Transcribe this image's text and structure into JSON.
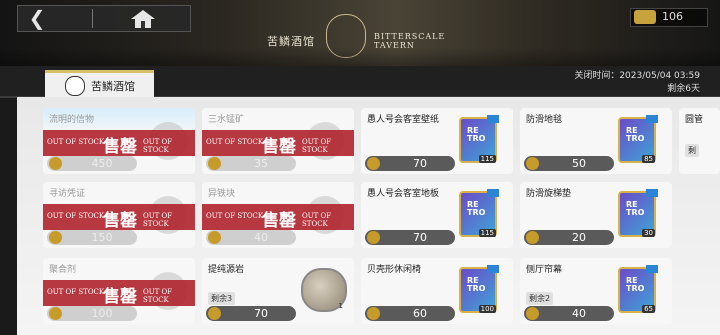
{
  "header": {
    "logo_cn": "苦鳞酒馆",
    "logo_en_line1": "BITTERSCALE",
    "logo_en_line2": "TAVERN",
    "currency_value": "106"
  },
  "tab": {
    "label": "苦鳞酒馆"
  },
  "close_info": {
    "label": "关闭时间：",
    "date": "2023/05/04 03:59",
    "remaining": "剩余6天"
  },
  "soldout": {
    "en": "OUT OF STOCK",
    "cn": "售罄"
  },
  "items": [
    {
      "name": "流明的信物",
      "price": "450",
      "sold_out": true
    },
    {
      "name": "三水锰矿",
      "price": "35",
      "sold_out": true
    },
    {
      "name": "愚人号会客室壁纸",
      "price": "70",
      "count": "115"
    },
    {
      "name": "防滑地毯",
      "price": "50",
      "count": "85"
    },
    {
      "name": "圆管",
      "remaining": "剩"
    },
    {
      "name": "寻访凭证",
      "price": "150",
      "sold_out": true
    },
    {
      "name": "异铁块",
      "price": "40",
      "sold_out": true
    },
    {
      "name": "愚人号会客室地板",
      "price": "70",
      "count": "115"
    },
    {
      "name": "防滑旋梯垫",
      "price": "20",
      "count": "30"
    },
    {
      "name": "聚合剂",
      "price": "100",
      "sold_out": true
    },
    {
      "name": "提纯源岩",
      "price": "70",
      "remaining": "剩余3",
      "count": "1"
    },
    {
      "name": "贝壳形休闲椅",
      "price": "60",
      "count": "100"
    },
    {
      "name": "侧厅帘幕",
      "price": "40",
      "remaining": "剩余2",
      "count": "65"
    }
  ]
}
